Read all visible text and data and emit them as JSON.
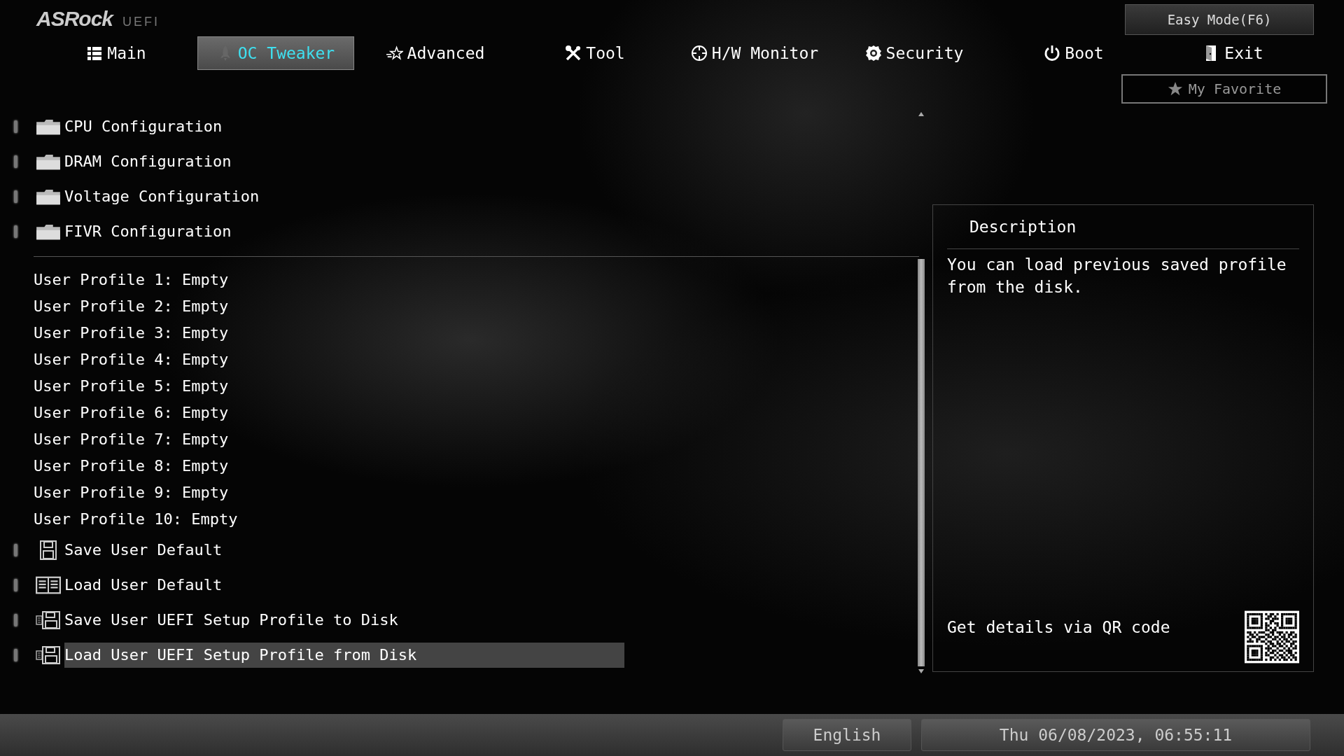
{
  "logo": {
    "brand": "ASRock",
    "suffix": "UEFI"
  },
  "easy_mode_button": "Easy Mode(F6)",
  "tabs": [
    {
      "label": "Main",
      "kind": "list",
      "selected": false
    },
    {
      "label": "OC Tweaker",
      "kind": "rocket",
      "selected": true
    },
    {
      "label": "Advanced",
      "kind": "star",
      "selected": false
    },
    {
      "label": "Tool",
      "kind": "tools",
      "selected": false
    },
    {
      "label": "H/W Monitor",
      "kind": "monitor",
      "selected": false
    },
    {
      "label": "Security",
      "kind": "shield",
      "selected": false
    },
    {
      "label": "Boot",
      "kind": "power",
      "selected": false
    },
    {
      "label": "Exit",
      "kind": "door",
      "selected": false
    }
  ],
  "favorite_button": {
    "label": "My Favorite"
  },
  "menu_groups": [
    {
      "kind": "submenus",
      "items": [
        {
          "label": "CPU Configuration",
          "kind": "folder",
          "selected": false
        },
        {
          "label": "DRAM Configuration",
          "kind": "folder",
          "selected": false
        },
        {
          "label": "Voltage Configuration",
          "kind": "folder",
          "selected": false
        },
        {
          "label": "FIVR Configuration",
          "kind": "folder",
          "selected": false
        }
      ]
    },
    {
      "kind": "profiles",
      "items": [
        {
          "label": "User Profile 1: Empty",
          "kind": "profile",
          "selected": false
        },
        {
          "label": "User Profile 2: Empty",
          "kind": "profile",
          "selected": false
        },
        {
          "label": "User Profile 3: Empty",
          "kind": "profile",
          "selected": false
        },
        {
          "label": "User Profile 4: Empty",
          "kind": "profile",
          "selected": false
        },
        {
          "label": "User Profile 5: Empty",
          "kind": "profile",
          "selected": false
        },
        {
          "label": "User Profile 6: Empty",
          "kind": "profile",
          "selected": false
        },
        {
          "label": "User Profile 7: Empty",
          "kind": "profile",
          "selected": false
        },
        {
          "label": "User Profile 8: Empty",
          "kind": "profile",
          "selected": false
        },
        {
          "label": "User Profile 9: Empty",
          "kind": "profile",
          "selected": false
        },
        {
          "label": "User Profile 10: Empty",
          "kind": "profile",
          "selected": false
        },
        {
          "label": "Save User Default",
          "kind": "save",
          "selected": false
        },
        {
          "label": "Load User Default",
          "kind": "book",
          "selected": false
        },
        {
          "label": "Save User UEFI Setup Profile to Disk",
          "kind": "disk",
          "selected": false
        },
        {
          "label": "Load User UEFI Setup Profile from Disk",
          "kind": "disk",
          "selected": true
        }
      ]
    }
  ],
  "description": {
    "title": "Description",
    "text": "You can load previous saved profile from the disk.",
    "qr_caption": "Get details via QR code"
  },
  "status_bar": {
    "language": "English",
    "datetime": "Thu 06/08/2023, 06:55:11"
  }
}
